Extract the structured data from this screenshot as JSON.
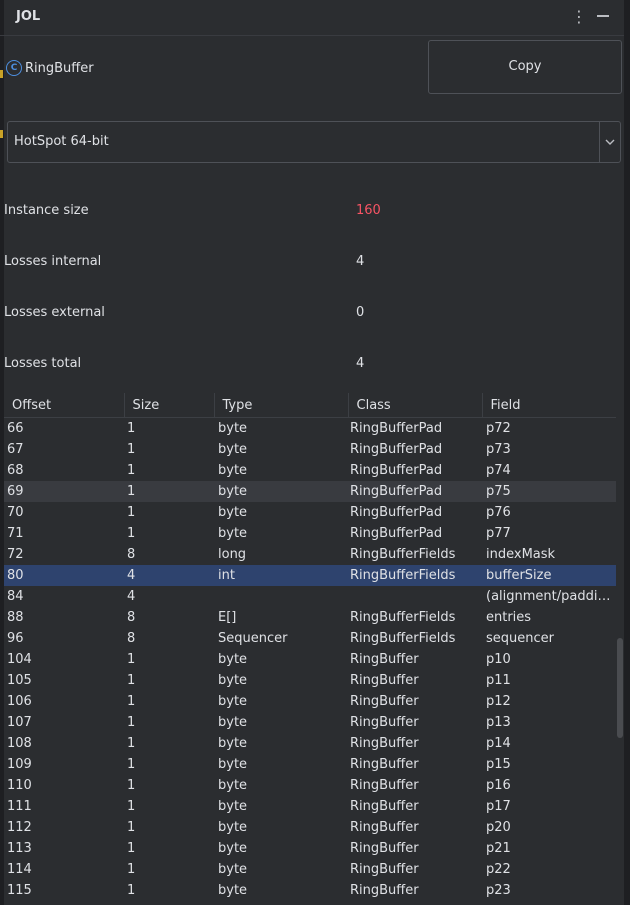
{
  "panel": {
    "title": "JOL",
    "more_icon": "more-vertical-icon",
    "minimize_icon": "minimize-icon"
  },
  "class_info": {
    "icon": "class-icon",
    "icon_glyph": "C",
    "name": "RingBuffer"
  },
  "copy_button": {
    "label": "Copy"
  },
  "vm_select": {
    "value": "HotSpot 64-bit",
    "arrow_icon": "chevron-down-icon"
  },
  "stats": {
    "instance_size_label": "Instance size",
    "instance_size_value": "160",
    "losses_internal_label": "Losses internal",
    "losses_internal_value": "4",
    "losses_external_label": "Losses external",
    "losses_external_value": "0",
    "losses_total_label": "Losses total",
    "losses_total_value": "4"
  },
  "colors": {
    "accent_red": "#f75464",
    "selection": "#2e436e",
    "class_icon": "#4d8fe0"
  },
  "table": {
    "columns": [
      "Offset",
      "Size",
      "Type",
      "Class",
      "Field"
    ],
    "rows": [
      [
        "66",
        "1",
        "byte",
        "RingBufferPad",
        "p72"
      ],
      [
        "67",
        "1",
        "byte",
        "RingBufferPad",
        "p73"
      ],
      [
        "68",
        "1",
        "byte",
        "RingBufferPad",
        "p74"
      ],
      [
        "69",
        "1",
        "byte",
        "RingBufferPad",
        "p75"
      ],
      [
        "70",
        "1",
        "byte",
        "RingBufferPad",
        "p76"
      ],
      [
        "71",
        "1",
        "byte",
        "RingBufferPad",
        "p77"
      ],
      [
        "72",
        "8",
        "long",
        "RingBufferFields",
        "indexMask"
      ],
      [
        "80",
        "4",
        "int",
        "RingBufferFields",
        "bufferSize"
      ],
      [
        "84",
        "4",
        "",
        "",
        "(alignment/paddin..."
      ],
      [
        "88",
        "8",
        "E[]",
        "RingBufferFields",
        "entries"
      ],
      [
        "96",
        "8",
        "Sequencer",
        "RingBufferFields",
        "sequencer"
      ],
      [
        "104",
        "1",
        "byte",
        "RingBuffer",
        "p10"
      ],
      [
        "105",
        "1",
        "byte",
        "RingBuffer",
        "p11"
      ],
      [
        "106",
        "1",
        "byte",
        "RingBuffer",
        "p12"
      ],
      [
        "107",
        "1",
        "byte",
        "RingBuffer",
        "p13"
      ],
      [
        "108",
        "1",
        "byte",
        "RingBuffer",
        "p14"
      ],
      [
        "109",
        "1",
        "byte",
        "RingBuffer",
        "p15"
      ],
      [
        "110",
        "1",
        "byte",
        "RingBuffer",
        "p16"
      ],
      [
        "111",
        "1",
        "byte",
        "RingBuffer",
        "p17"
      ],
      [
        "112",
        "1",
        "byte",
        "RingBuffer",
        "p20"
      ],
      [
        "113",
        "1",
        "byte",
        "RingBuffer",
        "p21"
      ],
      [
        "114",
        "1",
        "byte",
        "RingBuffer",
        "p22"
      ],
      [
        "115",
        "1",
        "byte",
        "RingBuffer",
        "p23"
      ]
    ],
    "hover_row_index": 3,
    "selected_row_index": 7
  }
}
